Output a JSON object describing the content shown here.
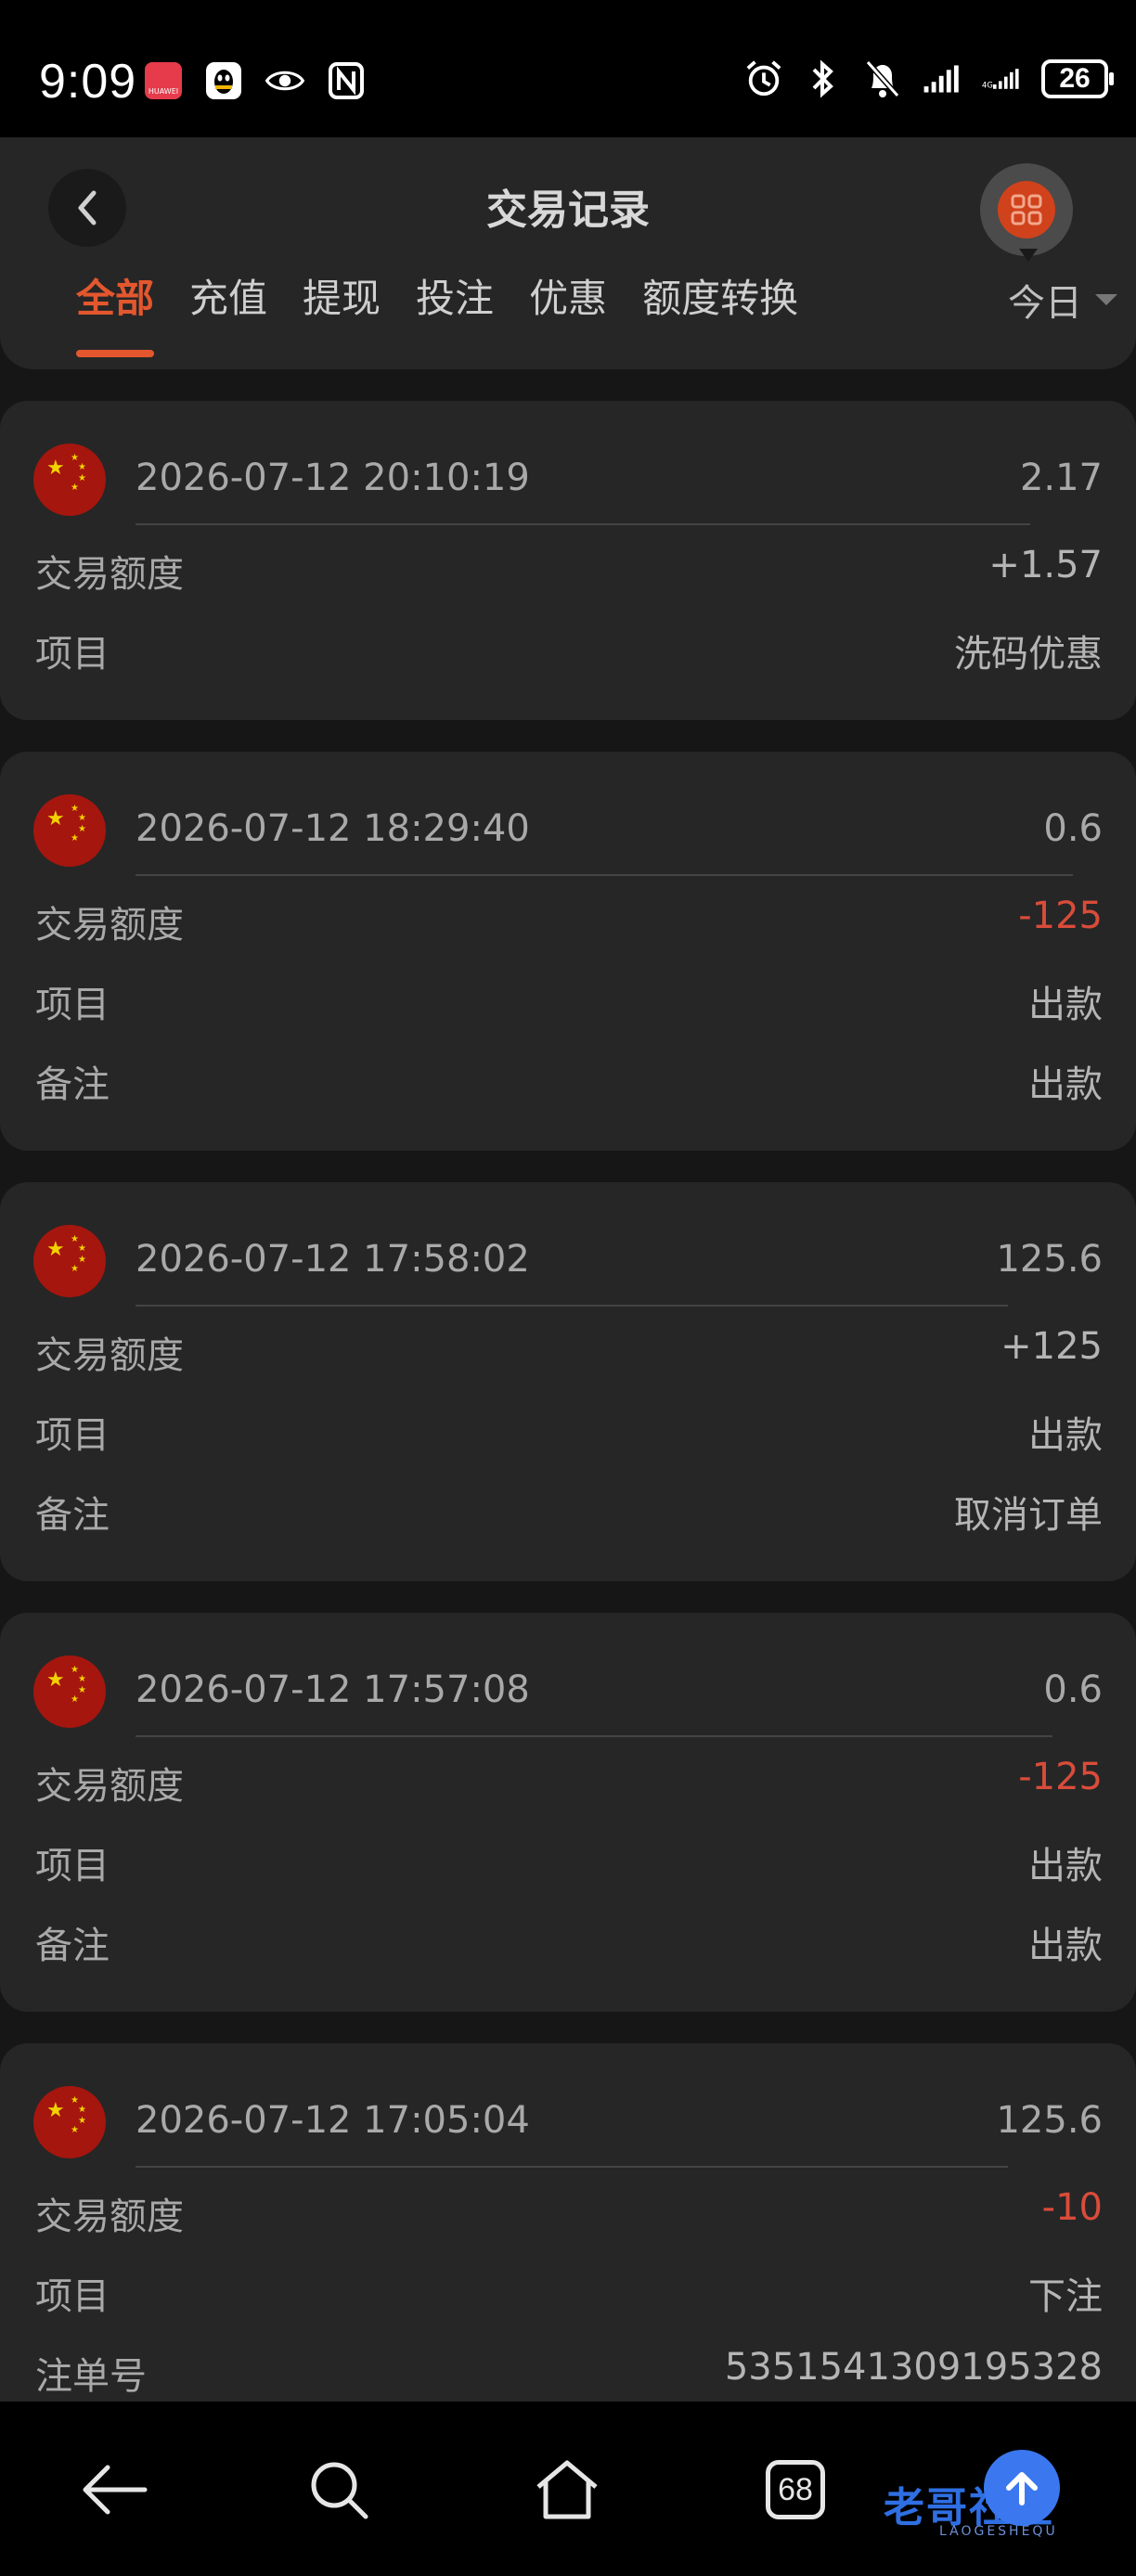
{
  "status_bar": {
    "time": "9:09",
    "battery": "26",
    "huawei_label": "HUAWEI"
  },
  "header": {
    "title": "交易记录",
    "tabs": [
      {
        "label": "全部"
      },
      {
        "label": "充值"
      },
      {
        "label": "提现"
      },
      {
        "label": "投注"
      },
      {
        "label": "优惠"
      },
      {
        "label": "额度转换"
      }
    ],
    "date_filter": "今日"
  },
  "records": [
    {
      "time": "2026-07-12 20:10:19",
      "balance": "2.17",
      "rows": [
        {
          "k": "交易额度",
          "v": "+1.57"
        },
        {
          "k": "项目",
          "v": "洗码优惠"
        }
      ]
    },
    {
      "time": "2026-07-12 18:29:40",
      "balance": "0.6",
      "rows": [
        {
          "k": "交易额度",
          "v": "-125"
        },
        {
          "k": "项目",
          "v": "出款"
        },
        {
          "k": "备注",
          "v": "出款"
        }
      ]
    },
    {
      "time": "2026-07-12 17:58:02",
      "balance": "125.6",
      "rows": [
        {
          "k": "交易额度",
          "v": "+125"
        },
        {
          "k": "项目",
          "v": "出款"
        },
        {
          "k": "备注",
          "v": "取消订单"
        }
      ]
    },
    {
      "time": "2026-07-12 17:57:08",
      "balance": "0.6",
      "rows": [
        {
          "k": "交易额度",
          "v": "-125"
        },
        {
          "k": "项目",
          "v": "出款"
        },
        {
          "k": "备注",
          "v": "出款"
        }
      ]
    },
    {
      "time": "2026-07-12 17:05:04",
      "balance": "125.6",
      "rows": [
        {
          "k": "交易额度",
          "v": "-10"
        },
        {
          "k": "项目",
          "v": "下注"
        },
        {
          "k": "注单号",
          "v": "5351541309195328"
        }
      ]
    }
  ],
  "navbar": {
    "tab_count": "68",
    "watermark": "老哥社区",
    "watermark_sub": "LAOGESHEQU"
  },
  "colors": {
    "accent": "#e4572e",
    "negative": "#d94c3a",
    "card": "#262626",
    "background": "#161616"
  }
}
